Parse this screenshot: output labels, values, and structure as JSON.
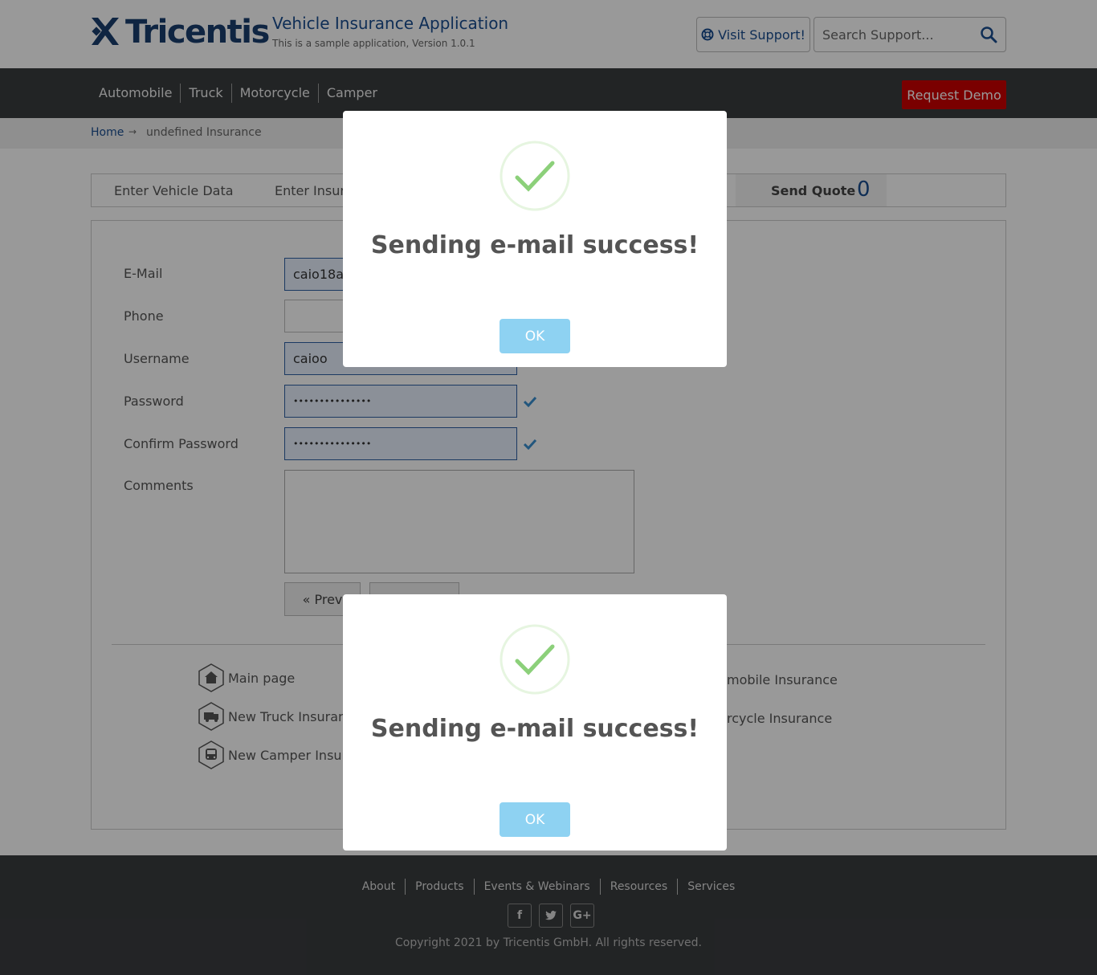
{
  "header": {
    "logo_text": "Tricentis",
    "app_title": "Vehicle Insurance Application",
    "app_subtitle": "This is a sample application, Version 1.0.1",
    "support_label": "Visit Support!",
    "search_placeholder": "Search Support..."
  },
  "nav": {
    "items": [
      "Automobile",
      "Truck",
      "Motorcycle",
      "Camper"
    ],
    "demo_label": "Request Demo"
  },
  "breadcrumb": {
    "home": "Home",
    "arrow": "→",
    "current": "undefined Insurance"
  },
  "tabs": {
    "vehicle": "Enter Vehicle Data",
    "insurant": "Enter Insura",
    "send_quote": "Send Quote",
    "send_quote_count": "0"
  },
  "form": {
    "email_label": "E-Mail",
    "email_value": "caio18au",
    "phone_label": "Phone",
    "phone_value": "",
    "username_label": "Username",
    "username_value": "caioo",
    "password_label": "Password",
    "password_value": "•••••••••••••••",
    "confirm_label": "Confirm Password",
    "confirm_value": "•••••••••••••••",
    "comments_label": "Comments",
    "prev_label": "« Prev"
  },
  "links": {
    "main_page": "Main page",
    "truck": "New Truck Insuranc",
    "camper": "New Camper Insura",
    "automobile": "mobile Insurance",
    "motorcycle": "rcycle Insurance"
  },
  "footer": {
    "links": [
      "About",
      "Products",
      "Events & Webinars",
      "Resources",
      "Services"
    ],
    "socials": [
      "f",
      "t",
      "G+"
    ],
    "copyright": "Copyright 2021 by Tricentis GmbH. All rights reserved."
  },
  "modals": [
    {
      "title": "Sending e-mail success!",
      "ok_label": "OK"
    },
    {
      "title": "Sending e-mail success!",
      "ok_label": "OK"
    }
  ],
  "colors": {
    "brand": "#1a3e6e",
    "nav_bg": "#3a3c3f",
    "demo_button": "#cc0000",
    "ok_button": "#8ed2f2",
    "success_check": "#8cd07a"
  }
}
